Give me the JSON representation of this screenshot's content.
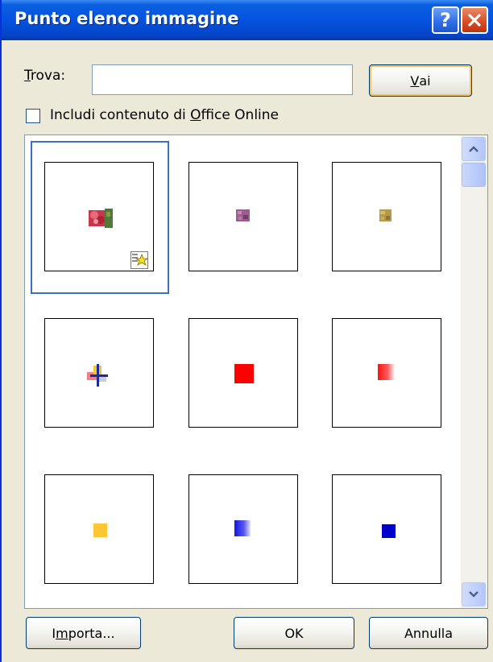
{
  "window": {
    "title": "Punto elenco immagine",
    "help_glyph": "?",
    "accent": "#0553e0"
  },
  "search": {
    "label_prefix": "",
    "label_accel": "T",
    "label_rest": "rova:",
    "value": "",
    "placeholder": "",
    "go_accel": "V",
    "go_rest": "ai"
  },
  "office_online": {
    "checked": false,
    "label_before": "Includi contenuto di ",
    "label_accel": "O",
    "label_after": "ffice Online"
  },
  "gallery": {
    "items": [
      {
        "name": "flower-picture-bullet",
        "selected": true,
        "colors": [
          "#d2404f",
          "#6b8e3a"
        ]
      },
      {
        "name": "purple-textured-bullet",
        "selected": false,
        "colors": [
          "#9a5f8f"
        ]
      },
      {
        "name": "gold-textured-bullet",
        "selected": false,
        "colors": [
          "#b49a4a"
        ]
      },
      {
        "name": "yellow-blue-cross-bullet",
        "selected": false,
        "colors": [
          "#f3c53a",
          "#1c2a9c",
          "#f28080"
        ]
      },
      {
        "name": "red-square-bullet",
        "selected": false,
        "colors": [
          "#ff0000"
        ]
      },
      {
        "name": "red-gradient-square-bullet",
        "selected": false,
        "colors": [
          "#ff0000",
          "#ffffff"
        ]
      },
      {
        "name": "yellow-square-bullet",
        "selected": false,
        "colors": [
          "#ffc633"
        ]
      },
      {
        "name": "blue-gradient-square-bullet",
        "selected": false,
        "colors": [
          "#1414e6",
          "#ffffff"
        ]
      },
      {
        "name": "blue-square-bullet",
        "selected": false,
        "colors": [
          "#0000cc"
        ]
      }
    ],
    "clipart_badge": "star-clipart-icon"
  },
  "footer": {
    "import_before": "I",
    "import_accel": "m",
    "import_after": "porta...",
    "ok": "OK",
    "cancel": "Annulla"
  }
}
